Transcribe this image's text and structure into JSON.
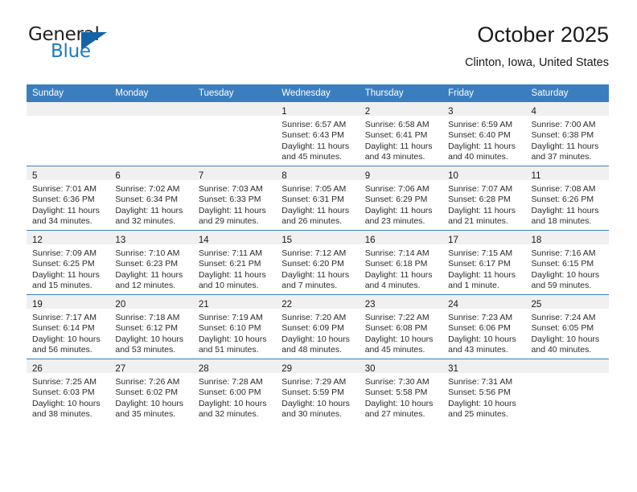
{
  "brand": {
    "name_top": "General",
    "name_bottom": "Blue",
    "triangle_color": "#1463a8",
    "blue_text_color": "#1f7ac0"
  },
  "header": {
    "title": "October 2025",
    "location": "Clinton, Iowa, United States"
  },
  "theme": {
    "header_blue": "#3a7ebf",
    "daynum_band": "#f0f0f0",
    "text": "#2b2b2b"
  },
  "weekday_headers": [
    "Sunday",
    "Monday",
    "Tuesday",
    "Wednesday",
    "Thursday",
    "Friday",
    "Saturday"
  ],
  "labels": {
    "sunrise_prefix": "Sunrise:",
    "sunset_prefix": "Sunset:",
    "daylight_prefix": "Daylight:"
  },
  "weeks": [
    [
      {
        "day": "",
        "empty": true
      },
      {
        "day": "",
        "empty": true
      },
      {
        "day": "",
        "empty": true
      },
      {
        "day": "1",
        "sunrise": "Sunrise: 6:57 AM",
        "sunset": "Sunset: 6:43 PM",
        "daylight1": "Daylight: 11 hours",
        "daylight2": "and 45 minutes."
      },
      {
        "day": "2",
        "sunrise": "Sunrise: 6:58 AM",
        "sunset": "Sunset: 6:41 PM",
        "daylight1": "Daylight: 11 hours",
        "daylight2": "and 43 minutes."
      },
      {
        "day": "3",
        "sunrise": "Sunrise: 6:59 AM",
        "sunset": "Sunset: 6:40 PM",
        "daylight1": "Daylight: 11 hours",
        "daylight2": "and 40 minutes."
      },
      {
        "day": "4",
        "sunrise": "Sunrise: 7:00 AM",
        "sunset": "Sunset: 6:38 PM",
        "daylight1": "Daylight: 11 hours",
        "daylight2": "and 37 minutes."
      }
    ],
    [
      {
        "day": "5",
        "sunrise": "Sunrise: 7:01 AM",
        "sunset": "Sunset: 6:36 PM",
        "daylight1": "Daylight: 11 hours",
        "daylight2": "and 34 minutes."
      },
      {
        "day": "6",
        "sunrise": "Sunrise: 7:02 AM",
        "sunset": "Sunset: 6:34 PM",
        "daylight1": "Daylight: 11 hours",
        "daylight2": "and 32 minutes."
      },
      {
        "day": "7",
        "sunrise": "Sunrise: 7:03 AM",
        "sunset": "Sunset: 6:33 PM",
        "daylight1": "Daylight: 11 hours",
        "daylight2": "and 29 minutes."
      },
      {
        "day": "8",
        "sunrise": "Sunrise: 7:05 AM",
        "sunset": "Sunset: 6:31 PM",
        "daylight1": "Daylight: 11 hours",
        "daylight2": "and 26 minutes."
      },
      {
        "day": "9",
        "sunrise": "Sunrise: 7:06 AM",
        "sunset": "Sunset: 6:29 PM",
        "daylight1": "Daylight: 11 hours",
        "daylight2": "and 23 minutes."
      },
      {
        "day": "10",
        "sunrise": "Sunrise: 7:07 AM",
        "sunset": "Sunset: 6:28 PM",
        "daylight1": "Daylight: 11 hours",
        "daylight2": "and 21 minutes."
      },
      {
        "day": "11",
        "sunrise": "Sunrise: 7:08 AM",
        "sunset": "Sunset: 6:26 PM",
        "daylight1": "Daylight: 11 hours",
        "daylight2": "and 18 minutes."
      }
    ],
    [
      {
        "day": "12",
        "sunrise": "Sunrise: 7:09 AM",
        "sunset": "Sunset: 6:25 PM",
        "daylight1": "Daylight: 11 hours",
        "daylight2": "and 15 minutes."
      },
      {
        "day": "13",
        "sunrise": "Sunrise: 7:10 AM",
        "sunset": "Sunset: 6:23 PM",
        "daylight1": "Daylight: 11 hours",
        "daylight2": "and 12 minutes."
      },
      {
        "day": "14",
        "sunrise": "Sunrise: 7:11 AM",
        "sunset": "Sunset: 6:21 PM",
        "daylight1": "Daylight: 11 hours",
        "daylight2": "and 10 minutes."
      },
      {
        "day": "15",
        "sunrise": "Sunrise: 7:12 AM",
        "sunset": "Sunset: 6:20 PM",
        "daylight1": "Daylight: 11 hours",
        "daylight2": "and 7 minutes."
      },
      {
        "day": "16",
        "sunrise": "Sunrise: 7:14 AM",
        "sunset": "Sunset: 6:18 PM",
        "daylight1": "Daylight: 11 hours",
        "daylight2": "and 4 minutes."
      },
      {
        "day": "17",
        "sunrise": "Sunrise: 7:15 AM",
        "sunset": "Sunset: 6:17 PM",
        "daylight1": "Daylight: 11 hours",
        "daylight2": "and 1 minute."
      },
      {
        "day": "18",
        "sunrise": "Sunrise: 7:16 AM",
        "sunset": "Sunset: 6:15 PM",
        "daylight1": "Daylight: 10 hours",
        "daylight2": "and 59 minutes."
      }
    ],
    [
      {
        "day": "19",
        "sunrise": "Sunrise: 7:17 AM",
        "sunset": "Sunset: 6:14 PM",
        "daylight1": "Daylight: 10 hours",
        "daylight2": "and 56 minutes."
      },
      {
        "day": "20",
        "sunrise": "Sunrise: 7:18 AM",
        "sunset": "Sunset: 6:12 PM",
        "daylight1": "Daylight: 10 hours",
        "daylight2": "and 53 minutes."
      },
      {
        "day": "21",
        "sunrise": "Sunrise: 7:19 AM",
        "sunset": "Sunset: 6:10 PM",
        "daylight1": "Daylight: 10 hours",
        "daylight2": "and 51 minutes."
      },
      {
        "day": "22",
        "sunrise": "Sunrise: 7:20 AM",
        "sunset": "Sunset: 6:09 PM",
        "daylight1": "Daylight: 10 hours",
        "daylight2": "and 48 minutes."
      },
      {
        "day": "23",
        "sunrise": "Sunrise: 7:22 AM",
        "sunset": "Sunset: 6:08 PM",
        "daylight1": "Daylight: 10 hours",
        "daylight2": "and 45 minutes."
      },
      {
        "day": "24",
        "sunrise": "Sunrise: 7:23 AM",
        "sunset": "Sunset: 6:06 PM",
        "daylight1": "Daylight: 10 hours",
        "daylight2": "and 43 minutes."
      },
      {
        "day": "25",
        "sunrise": "Sunrise: 7:24 AM",
        "sunset": "Sunset: 6:05 PM",
        "daylight1": "Daylight: 10 hours",
        "daylight2": "and 40 minutes."
      }
    ],
    [
      {
        "day": "26",
        "sunrise": "Sunrise: 7:25 AM",
        "sunset": "Sunset: 6:03 PM",
        "daylight1": "Daylight: 10 hours",
        "daylight2": "and 38 minutes."
      },
      {
        "day": "27",
        "sunrise": "Sunrise: 7:26 AM",
        "sunset": "Sunset: 6:02 PM",
        "daylight1": "Daylight: 10 hours",
        "daylight2": "and 35 minutes."
      },
      {
        "day": "28",
        "sunrise": "Sunrise: 7:28 AM",
        "sunset": "Sunset: 6:00 PM",
        "daylight1": "Daylight: 10 hours",
        "daylight2": "and 32 minutes."
      },
      {
        "day": "29",
        "sunrise": "Sunrise: 7:29 AM",
        "sunset": "Sunset: 5:59 PM",
        "daylight1": "Daylight: 10 hours",
        "daylight2": "and 30 minutes."
      },
      {
        "day": "30",
        "sunrise": "Sunrise: 7:30 AM",
        "sunset": "Sunset: 5:58 PM",
        "daylight1": "Daylight: 10 hours",
        "daylight2": "and 27 minutes."
      },
      {
        "day": "31",
        "sunrise": "Sunrise: 7:31 AM",
        "sunset": "Sunset: 5:56 PM",
        "daylight1": "Daylight: 10 hours",
        "daylight2": "and 25 minutes."
      },
      {
        "day": "",
        "empty": true
      }
    ]
  ]
}
